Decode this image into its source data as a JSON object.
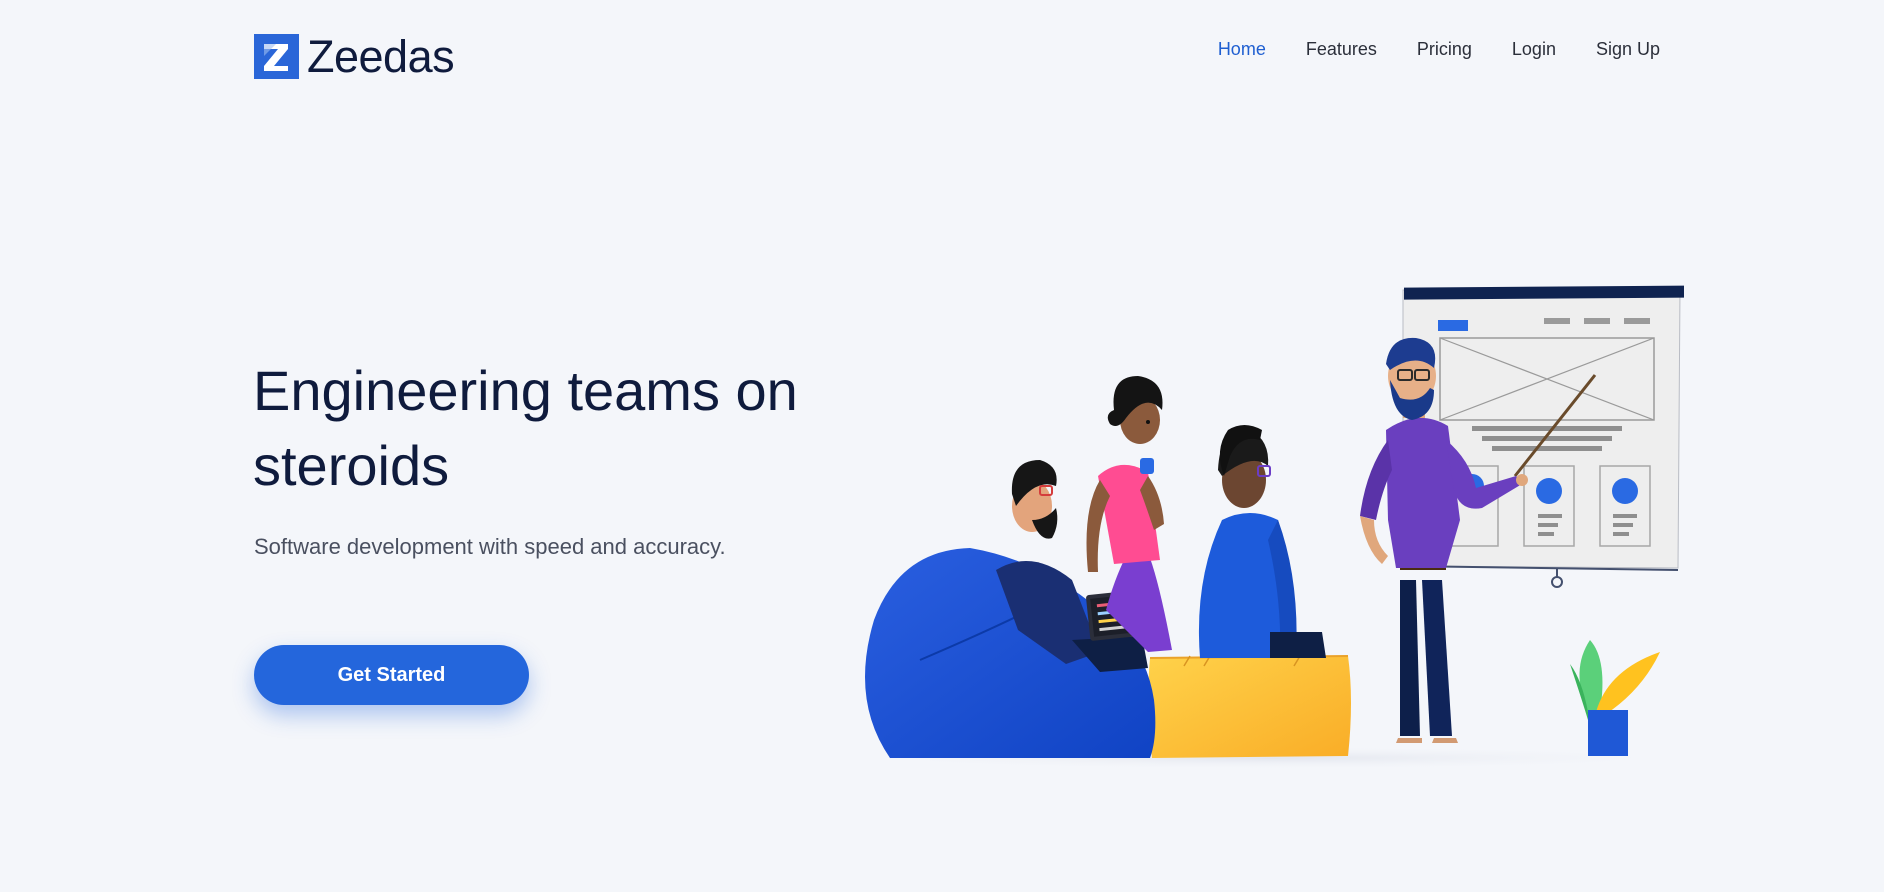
{
  "brand": {
    "name": "Zeedas",
    "logo_icon": "z-logo-icon",
    "accent_color": "#2466dc"
  },
  "nav": {
    "items": [
      {
        "label": "Home",
        "active": true
      },
      {
        "label": "Features",
        "active": false
      },
      {
        "label": "Pricing",
        "active": false
      },
      {
        "label": "Login",
        "active": false
      },
      {
        "label": "Sign Up",
        "active": false
      }
    ]
  },
  "hero": {
    "title": "Engineering teams on steroids",
    "subtitle": "Software development with speed and accuracy.",
    "cta_label": "Get Started"
  },
  "illustration": {
    "icon": "team-presentation-illustration"
  }
}
